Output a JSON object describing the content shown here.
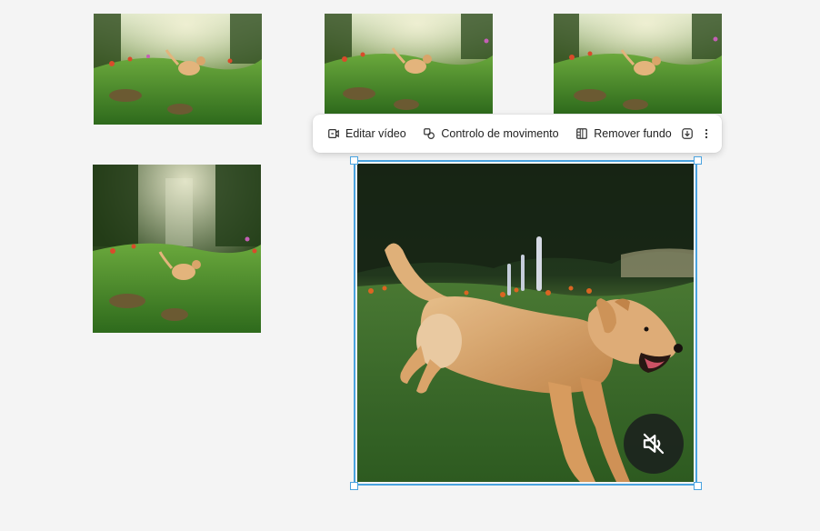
{
  "thumbnails": [
    {
      "name": "thumbnail-1",
      "variant": "forest-dog-small"
    },
    {
      "name": "thumbnail-2",
      "variant": "forest-dog-small"
    },
    {
      "name": "thumbnail-3",
      "variant": "forest-dog-small"
    },
    {
      "name": "thumbnail-4",
      "variant": "forest-dog-tall"
    }
  ],
  "toolbar": {
    "edit_video_label": "Editar vídeo",
    "motion_control_label": "Controlo de movimento",
    "remove_background_label": "Remover fundo",
    "icons": {
      "edit_video": "video-edit-icon",
      "motion_control": "motion-control-icon",
      "remove_background": "remove-background-icon",
      "download": "download-icon",
      "more": "more-vertical-icon"
    }
  },
  "main_video": {
    "subject": "golden retriever running in garden",
    "mute_icon": "volume-off-icon"
  },
  "colors": {
    "selection": "#4aa3df",
    "canvas_bg": "#f4f4f4",
    "toolbar_bg": "#ffffff"
  }
}
